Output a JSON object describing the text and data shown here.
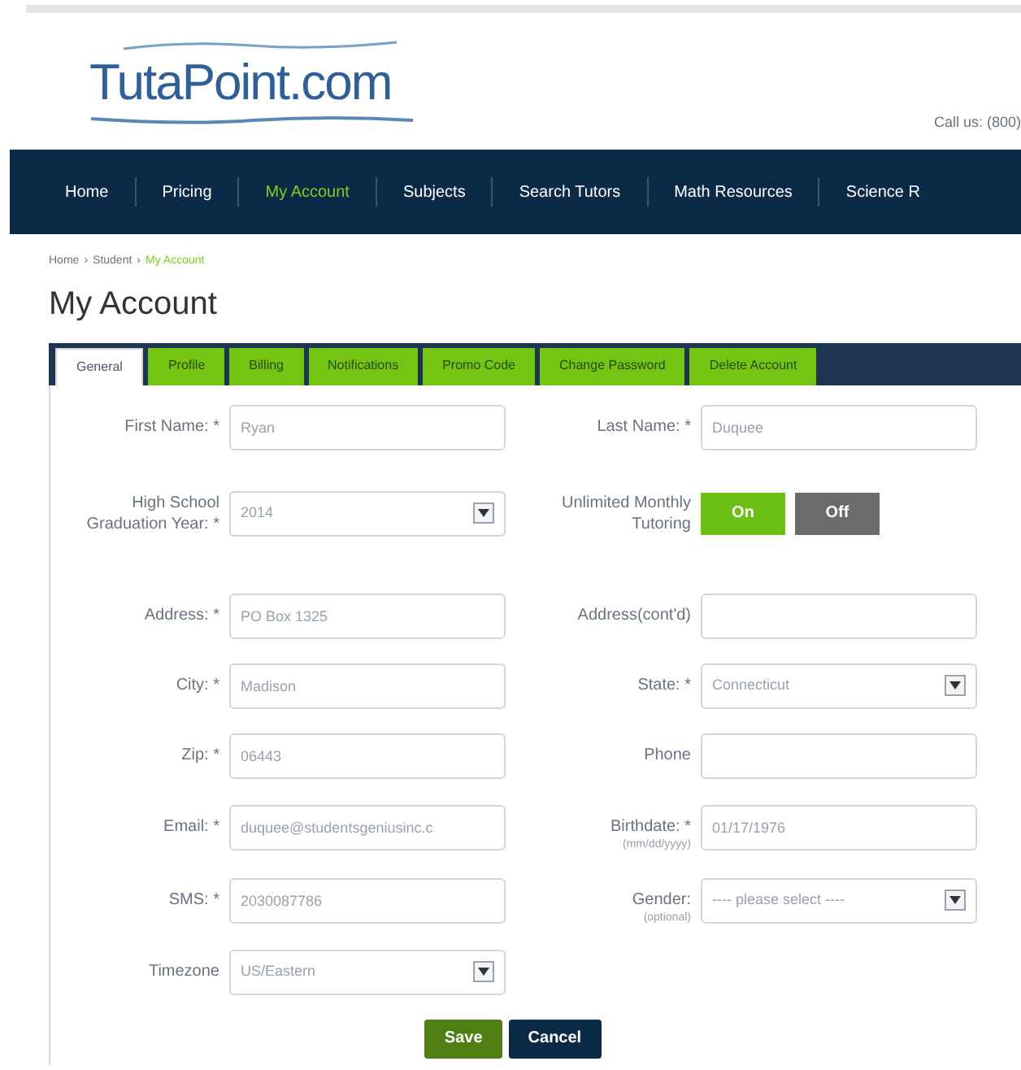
{
  "header": {
    "logo": "TutaPoint.com",
    "contact": "Call us: (800) "
  },
  "nav": [
    {
      "label": "Home",
      "selected": false
    },
    {
      "label": "Pricing",
      "selected": false
    },
    {
      "label": "My Account",
      "selected": true
    },
    {
      "label": "Subjects",
      "selected": false
    },
    {
      "label": "Search Tutors",
      "selected": false
    },
    {
      "label": "Math Resources",
      "selected": false
    },
    {
      "label": "Science R",
      "selected": false
    }
  ],
  "breadcrumb": [
    {
      "label": "Home",
      "current": false
    },
    {
      "label": "Student",
      "current": false
    },
    {
      "label": "My Account",
      "current": true
    }
  ],
  "breadcrumb_separator": "›",
  "title": "My Account",
  "tabs": [
    {
      "label": "General",
      "selected": true
    },
    {
      "label": "Profile",
      "selected": false
    },
    {
      "label": "Billing",
      "selected": false
    },
    {
      "label": "Notifications",
      "selected": false
    },
    {
      "label": "Promo Code",
      "selected": false
    },
    {
      "label": "Change Password",
      "selected": false
    },
    {
      "label": "Delete Account",
      "selected": false
    }
  ],
  "rows": [
    [
      {
        "kind": "text",
        "label": "First Name: *",
        "value": "Ryan"
      },
      {
        "kind": "text",
        "label": "Last Name: *",
        "value": "Duquee"
      }
    ],
    [
      {
        "kind": "select",
        "label": "High School Graduation Year: *",
        "value": "2014"
      },
      {
        "kind": "toggle",
        "label": "Unlimited Monthly Tutoring",
        "options": [
          {
            "label": "On",
            "selected": true
          },
          {
            "label": "Off",
            "selected": false
          }
        ]
      }
    ],
    [
      {
        "kind": "text",
        "label": "Address: *",
        "value": "PO Box 1325"
      },
      {
        "kind": "text",
        "label": "Address(cont'd)"
      }
    ],
    [
      {
        "kind": "text",
        "label": "City: *",
        "value": "Madison"
      },
      {
        "kind": "select",
        "label": "State: *",
        "value": "Connecticut"
      }
    ],
    [
      {
        "kind": "text",
        "label": "Zip: *",
        "value": "06443"
      },
      {
        "kind": "text",
        "label": "Phone"
      }
    ],
    [
      {
        "kind": "text",
        "label": "Email: *",
        "value": "duquee@studentsgeniusinc.c"
      },
      {
        "kind": "text",
        "label": "Birthdate: *",
        "hint": "(mm/dd/yyyy)",
        "value": "01/17/1976"
      }
    ],
    [
      {
        "kind": "text",
        "label": "SMS: *",
        "value": "2030087786"
      },
      {
        "kind": "select",
        "label": "Gender:",
        "hint": "(optional)",
        "value": "---- please select ----"
      }
    ],
    [
      {
        "kind": "select",
        "label": "Timezone",
        "value": "US/Eastern"
      }
    ]
  ],
  "buttons": [
    {
      "label": "Save",
      "kind": "primary"
    },
    {
      "label": "Cancel",
      "kind": "secondary"
    }
  ]
}
